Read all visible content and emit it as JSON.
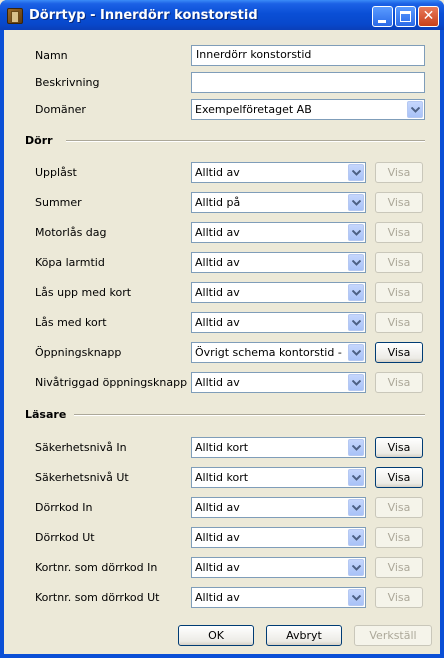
{
  "window": {
    "title": "Dörrtyp - Innerdörr konstorstid"
  },
  "general": {
    "name_label": "Namn",
    "name_value": "Innerdörr konstorstid",
    "desc_label": "Beskrivning",
    "desc_value": "",
    "domains_label": "Domäner",
    "domains_value": "Exempelföretaget AB"
  },
  "door_section": {
    "title": "Dörr",
    "rows": [
      {
        "label": "Upplåst",
        "value": "Alltid av",
        "visa": "Visa",
        "visa_enabled": false
      },
      {
        "label": "Summer",
        "value": "Alltid på",
        "visa": "Visa",
        "visa_enabled": false
      },
      {
        "label": "Motorlås dag",
        "value": "Alltid av",
        "visa": "Visa",
        "visa_enabled": false
      },
      {
        "label": "Köpa larmtid",
        "value": "Alltid av",
        "visa": "Visa",
        "visa_enabled": false
      },
      {
        "label": "Lås upp med kort",
        "value": "Alltid av",
        "visa": "Visa",
        "visa_enabled": false
      },
      {
        "label": "Lås med kort",
        "value": "Alltid av",
        "visa": "Visa",
        "visa_enabled": false
      },
      {
        "label": "Öppningsknapp",
        "value": "Övrigt schema kontorstid - F...",
        "visa": "Visa",
        "visa_enabled": true
      },
      {
        "label": "Nivåtriggad öppningsknapp",
        "value": "Alltid av",
        "visa": "Visa",
        "visa_enabled": false
      }
    ]
  },
  "reader_section": {
    "title": "Läsare",
    "rows": [
      {
        "label": "Säkerhetsnivå In",
        "value": "Alltid kort",
        "visa": "Visa",
        "visa_enabled": true
      },
      {
        "label": "Säkerhetsnivå Ut",
        "value": "Alltid kort",
        "visa": "Visa",
        "visa_enabled": true
      },
      {
        "label": "Dörrkod In",
        "value": "Alltid av",
        "visa": "Visa",
        "visa_enabled": false
      },
      {
        "label": "Dörrkod Ut",
        "value": "Alltid av",
        "visa": "Visa",
        "visa_enabled": false
      },
      {
        "label": "Kortnr. som dörrkod In",
        "value": "Alltid av",
        "visa": "Visa",
        "visa_enabled": false
      },
      {
        "label": "Kortnr. som dörrkod Ut",
        "value": "Alltid av",
        "visa": "Visa",
        "visa_enabled": false
      }
    ]
  },
  "footer": {
    "ok": "OK",
    "cancel": "Avbryt",
    "apply": "Verkställ"
  }
}
